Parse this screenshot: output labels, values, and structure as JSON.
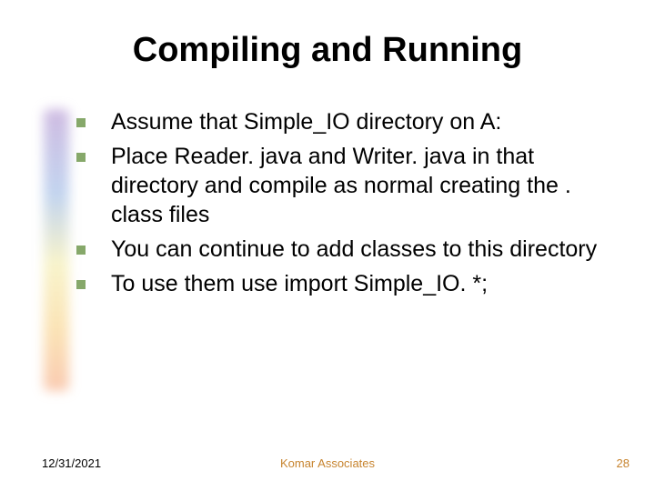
{
  "title": "Compiling and Running",
  "bullets": [
    "Assume that Simple_IO directory on  A:",
    "Place Reader. java and Writer. java in that directory and compile as normal creating the . class files",
    "You can continue to add classes to this directory",
    "To use them use import Simple_IO. *;"
  ],
  "footer": {
    "date": "12/31/2021",
    "org": "Komar Associates",
    "slide_number": "28"
  }
}
